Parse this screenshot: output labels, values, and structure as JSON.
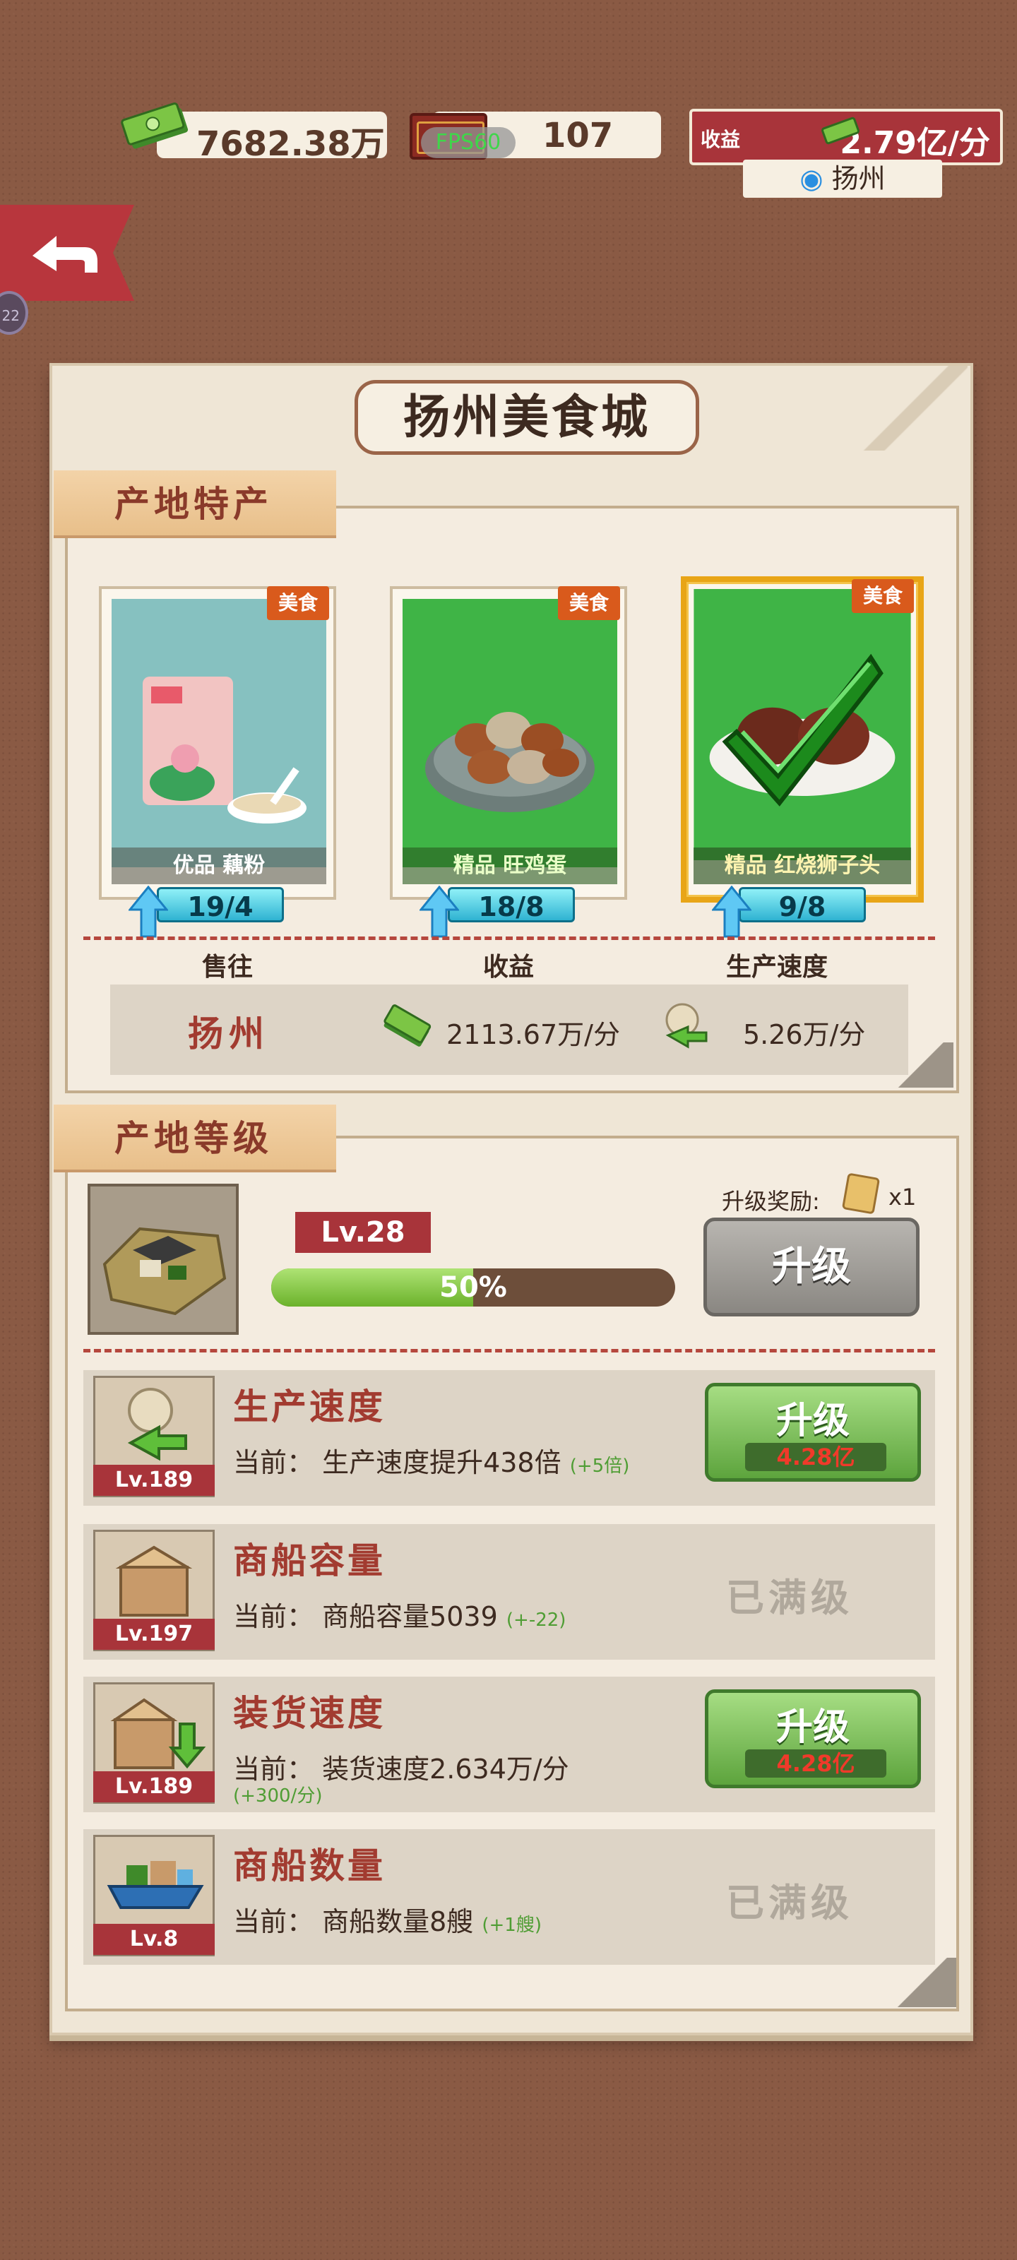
{
  "topbar": {
    "money": "7682.38万",
    "ticket_fps": "FPS60",
    "ticket_count": "107",
    "income_label": "收益",
    "income_value": "2.79亿/分",
    "location": "扬州",
    "side_badge": "22"
  },
  "panel": {
    "title": "扬州美食城",
    "specialty": {
      "section_label": "产地特产",
      "cards": [
        {
          "tag": "美食",
          "name": "优品  藕粉",
          "count": "19/4",
          "selected": false
        },
        {
          "tag": "美食",
          "name": "精品  旺鸡蛋",
          "count": "18/8",
          "selected": false
        },
        {
          "tag": "美食",
          "name": "精品  红烧狮子头",
          "count": "9/8",
          "selected": true
        }
      ],
      "columns": [
        "售往",
        "收益",
        "生产速度"
      ],
      "sell_to": "扬州",
      "income": "2113.67万/分",
      "speed": "5.26万/分"
    },
    "level": {
      "section_label": "产地等级",
      "level_badge": "Lv.28",
      "progress_percent": 50,
      "progress_text": "50%",
      "reward_label": "升级奖励:",
      "reward_count": "x1",
      "upgrade_label": "升级"
    },
    "upgrades": [
      {
        "title": "生产速度",
        "level": "Lv.189",
        "desc": "当前：  生产速度提升438倍",
        "bonus": "(+5倍)",
        "extra": "",
        "button": "升级",
        "cost": "4.28亿",
        "maxed": false
      },
      {
        "title": "商船容量",
        "level": "Lv.197",
        "desc": "当前：  商船容量5039",
        "bonus": "(+-22)",
        "extra": "",
        "button": "已满级",
        "cost": "",
        "maxed": true
      },
      {
        "title": "装货速度",
        "level": "Lv.189",
        "desc": "当前：  装货速度2.634万/分",
        "bonus": "",
        "extra": "(+300/分)",
        "button": "升级",
        "cost": "4.28亿",
        "maxed": false
      },
      {
        "title": "商船数量",
        "level": "Lv.8",
        "desc": "当前：  商船数量8艘",
        "bonus": "(+1艘)",
        "extra": "",
        "button": "已满级",
        "cost": "",
        "maxed": true
      }
    ]
  }
}
